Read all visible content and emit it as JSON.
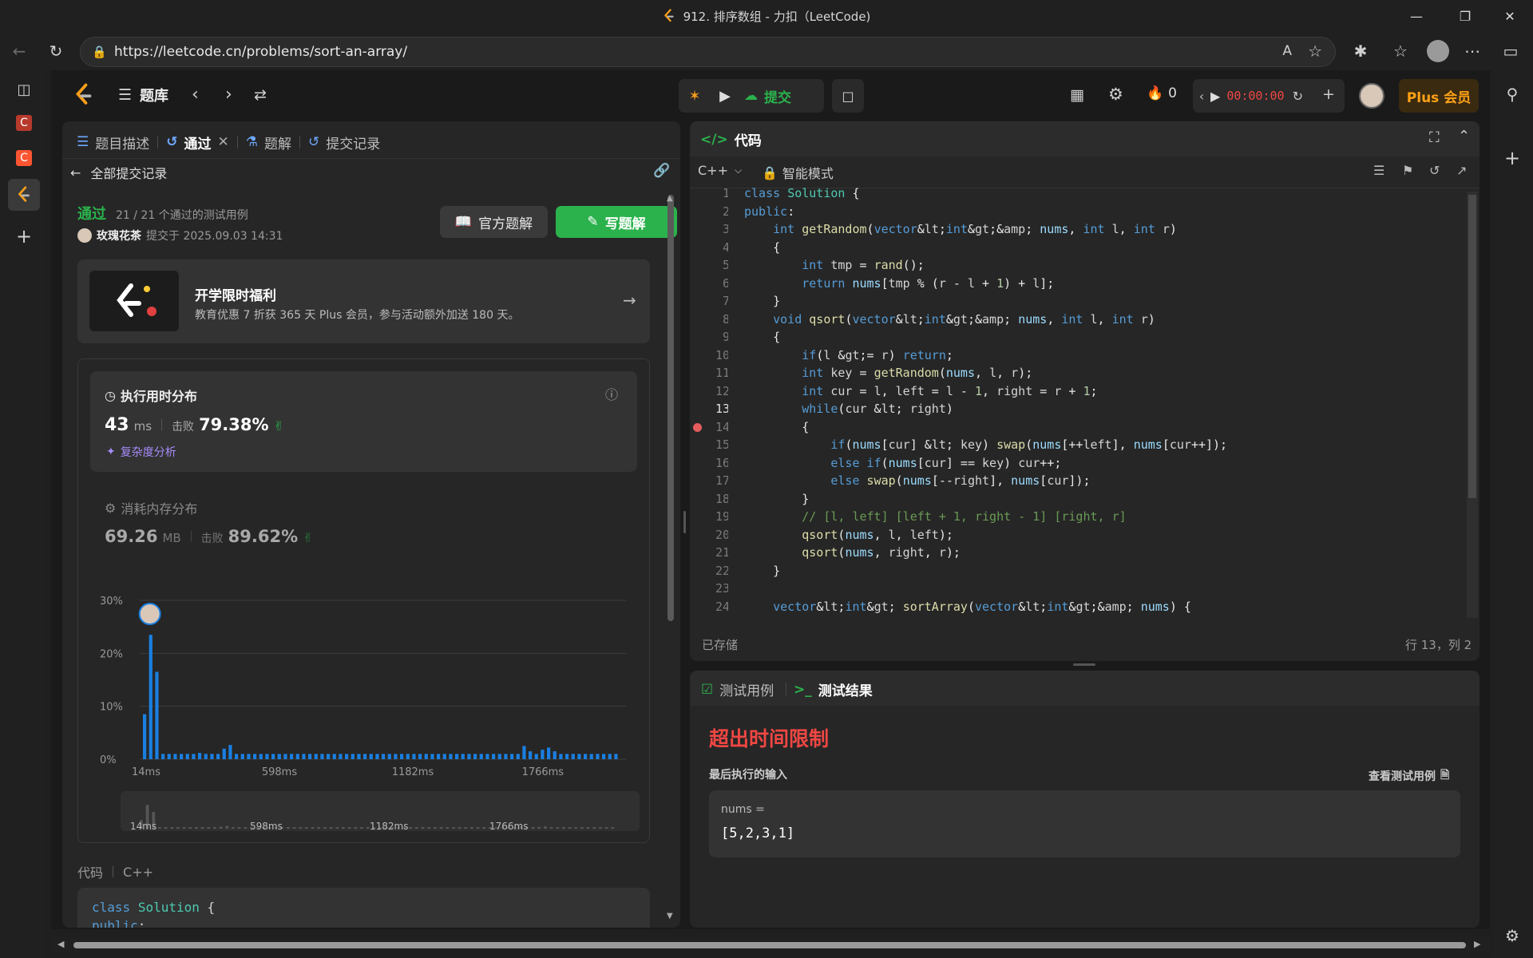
{
  "window": {
    "title": "912. 排序数组 - 力扣（LeetCode)"
  },
  "browser": {
    "url": "https://leetcode.cn/problems/sort-an-array/"
  },
  "topbar": {
    "problem_list": "题库",
    "submit_label": "提交",
    "streak_count": "0",
    "timer": "00:00:00",
    "plus_label": "Plus 会员"
  },
  "left_tabs": [
    {
      "label": "题目描述"
    },
    {
      "label": "通过"
    },
    {
      "label": "题解"
    },
    {
      "label": "提交记录"
    }
  ],
  "submission": {
    "back_label": "全部提交记录",
    "status": "通过",
    "testcases": "21 / 21 个通过的测试用例",
    "user": "玫瑰花茶",
    "submitted_at": "提交于 2025.09.03 14:31",
    "official_solution": "官方题解",
    "write_solution": "写题解"
  },
  "promo": {
    "title": "开学限时福利",
    "desc": "教育优惠 7 折获 365 天 Plus 会员，参与活动额外加送 180 天。"
  },
  "runtime": {
    "title": "执行用时分布",
    "value": "43",
    "unit": "ms",
    "beats_label": "击败",
    "beats": "79.38%",
    "complexity": "复杂度分析"
  },
  "memory": {
    "title": "消耗内存分布",
    "value": "69.26",
    "unit": "MB",
    "beats_label": "击败",
    "beats": "89.62%"
  },
  "chart_data": {
    "type": "bar",
    "ylim": [
      0,
      30
    ],
    "yticks": [
      "30%",
      "20%",
      "10%",
      "0%"
    ],
    "xticks": [
      "14ms",
      "598ms",
      "1182ms",
      "1766ms"
    ],
    "mini_xticks": [
      "14ms",
      "598ms",
      "1182ms",
      "1766ms"
    ],
    "values": [
      8.5,
      23.5,
      16.5,
      1,
      1,
      1,
      1,
      1,
      1,
      1.2,
      1,
      1,
      1,
      2,
      2.7,
      1,
      1,
      1,
      1,
      1,
      1,
      1,
      1,
      1,
      1,
      1,
      1,
      1,
      1,
      1,
      1,
      1,
      1,
      1,
      1,
      1,
      1,
      1,
      1,
      1,
      1,
      1,
      1,
      1,
      1,
      1,
      1,
      1,
      1,
      1,
      1,
      1,
      1,
      1,
      1,
      1,
      1,
      1,
      1,
      1,
      1,
      1,
      2.5,
      1.5,
      1,
      1.8,
      2.2,
      1.5,
      1,
      1,
      1,
      1,
      1,
      1,
      1,
      1,
      1,
      1
    ]
  },
  "submitted_code": {
    "label": "代码",
    "lang": "C++",
    "lines": [
      "class Solution {",
      "public:"
    ]
  },
  "editor": {
    "title": "代码",
    "language": "C++",
    "mode": "智能模式",
    "saved": "已存储",
    "cursor": "行 13，列 2",
    "breakpoint_line": 14,
    "active_line": 13,
    "lines": [
      "class Solution {",
      "public:",
      "    int getRandom(vector<int>& nums, int l, int r)",
      "    {",
      "        int tmp = rand();",
      "        return nums[tmp % (r - l + 1) + l];",
      "    }",
      "    void qsort(vector<int>& nums, int l, int r)",
      "    {",
      "        if(l >= r) return;",
      "        int key = getRandom(nums, l, r);",
      "        int cur = l, left = l - 1, right = r + 1;",
      "        while(cur < right)",
      "        {",
      "            if(nums[cur] < key) swap(nums[++left], nums[cur++]);",
      "            else if(nums[cur] == key) cur++;",
      "            else swap(nums[--right], nums[cur]);",
      "        }",
      "        // [l, left] [left + 1, right - 1] [right, r]",
      "        qsort(nums, l, left);",
      "        qsort(nums, right, r);",
      "    }",
      "",
      "    vector<int> sortArray(vector<int>& nums) {"
    ]
  },
  "testpanel": {
    "tab_cases": "测试用例",
    "tab_result": "测试结果",
    "verdict": "超出时间限制",
    "last_input_label": "最后执行的输入",
    "view_case": "查看测试用例",
    "input_name": "nums =",
    "input_value": "[5,2,3,1]"
  },
  "colors": {
    "accent_green": "#2bb24c",
    "error_red": "#ef4743",
    "bar_blue": "#1a7fe0",
    "plus_orange": "#ffa116"
  }
}
